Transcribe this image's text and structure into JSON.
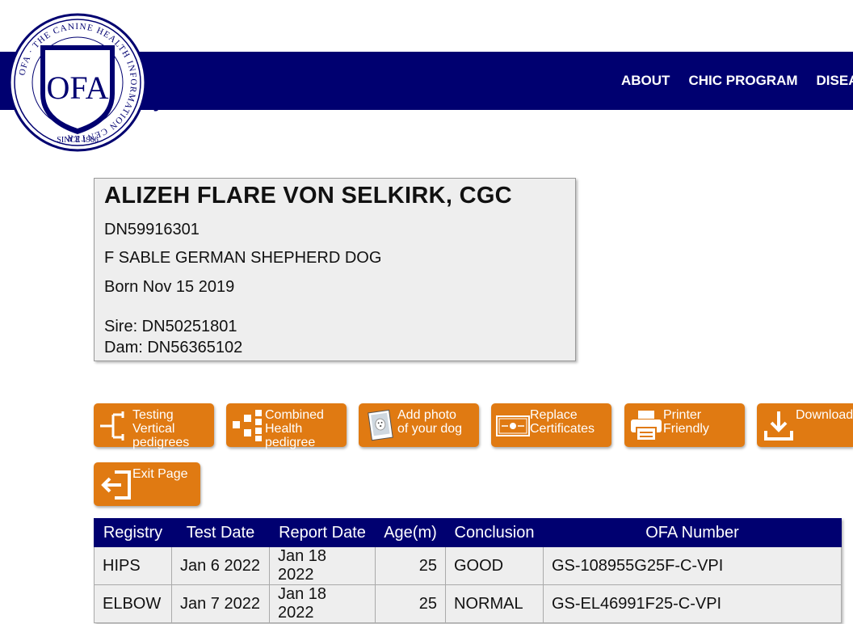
{
  "brand": {
    "logo_text": "OFA",
    "logo_ring_text": "OFA · THE CANINE HEALTH INFORMATION CENTER",
    "logo_since": "SINCE 1966",
    "navy": "#000070",
    "orange": "#e07a12"
  },
  "nav": {
    "items": [
      {
        "label": "ABOUT"
      },
      {
        "label": "CHIC PROGRAM"
      },
      {
        "label": "DISEA"
      }
    ]
  },
  "dog": {
    "name": "ALIZEH FLARE VON SELKIRK, CGC",
    "registration": "DN59916301",
    "description": "F SABLE GERMAN SHEPHERD DOG",
    "born": "Born Nov 15 2019",
    "sire": "Sire: DN50251801",
    "dam": "Dam: DN56365102"
  },
  "actions": [
    {
      "label": "Testing\nVertical\npedigrees",
      "icon": "vertical-pedigree-icon"
    },
    {
      "label": "Combined\nHealth\npedigree",
      "icon": "health-pedigree-icon"
    },
    {
      "label": "Add photo\nof your dog",
      "icon": "dog-photo-icon"
    },
    {
      "label": "Replace\nCertificates",
      "icon": "certificate-icon"
    },
    {
      "label": "Printer\nFriendly",
      "icon": "printer-icon"
    },
    {
      "label": "Download",
      "icon": "download-icon"
    },
    {
      "label": "Exit Page",
      "icon": "exit-icon"
    }
  ],
  "results": {
    "columns": [
      "Registry",
      "Test Date",
      "Report Date",
      "Age(m)",
      "Conclusion",
      "OFA Number"
    ],
    "rows": [
      {
        "registry": "HIPS",
        "test_date": "Jan 6 2022",
        "report_date": "Jan 18 2022",
        "age": "25",
        "conclusion": "GOOD",
        "ofa_number": "GS-108955G25F-C-VPI"
      },
      {
        "registry": "ELBOW",
        "test_date": "Jan 7 2022",
        "report_date": "Jan 18 2022",
        "age": "25",
        "conclusion": "NORMAL",
        "ofa_number": "GS-EL46991F25-C-VPI"
      }
    ]
  }
}
